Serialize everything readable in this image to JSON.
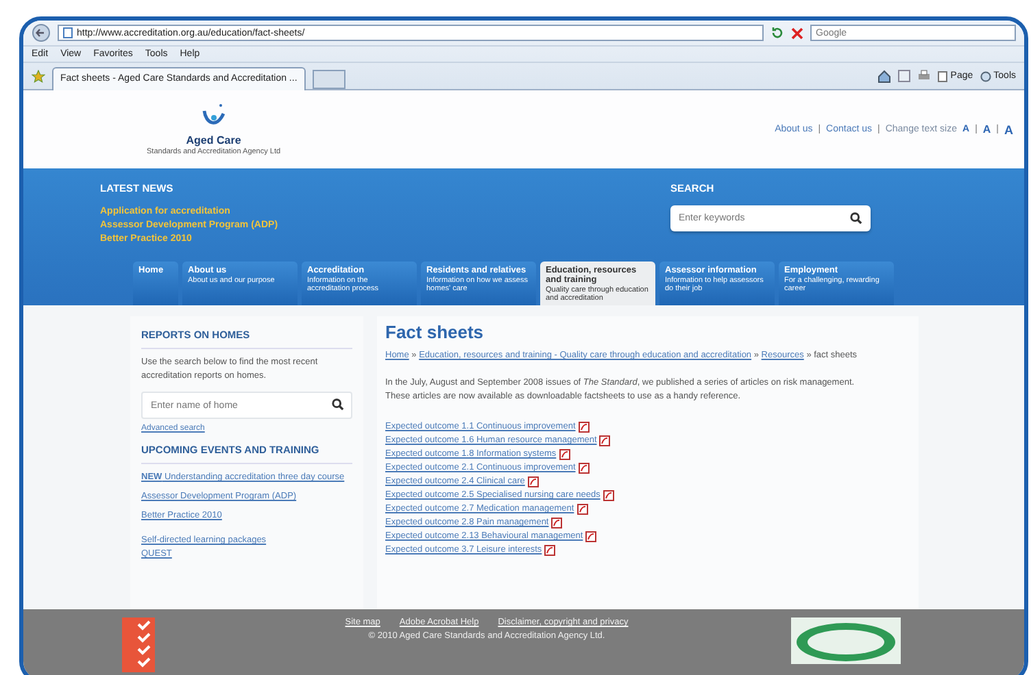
{
  "browser": {
    "address": "http://www.accreditation.org.au/education/fact-sheets/",
    "search_placeholder": "Google",
    "menu": [
      "Edit",
      "View",
      "Favorites",
      "Tools",
      "Help"
    ],
    "tabs": [
      {
        "label": "Fact sheets - Aged Care Standards and Accreditation ...",
        "selected": true
      }
    ],
    "toolbar": [
      "Page",
      "Tools"
    ]
  },
  "header": {
    "logo_title": "Aged Care",
    "logo_subtitle": "Standards and Accreditation Agency Ltd",
    "separator": "|",
    "links": [
      "About us",
      "Contact us"
    ],
    "text_size_label": "Change text size",
    "text_sizes": [
      "A",
      "A",
      "A"
    ]
  },
  "news": {
    "heading": "LATEST NEWS",
    "items": [
      "Application for accreditation",
      "Assessor Development Program (ADP)",
      "Better Practice 2010"
    ]
  },
  "search": {
    "heading": "SEARCH",
    "placeholder": "Enter keywords"
  },
  "nav": [
    {
      "title": "Home",
      "selected": false
    },
    {
      "title": "About us",
      "subtitle": "About us and our purpose",
      "selected": false
    },
    {
      "title": "Accreditation",
      "subtitle": "Information on the accreditation process",
      "selected": false
    },
    {
      "title": "Residents and relatives",
      "subtitle": "Information on how we assess homes' care",
      "selected": false
    },
    {
      "title": "Education, resources and training",
      "subtitle": "Quality care through education and accreditation",
      "selected": true
    },
    {
      "title": "Assessor information",
      "subtitle": "Information to help assessors do their job",
      "selected": false
    },
    {
      "title": "Employment",
      "subtitle": "For a challenging, rewarding career",
      "selected": false
    }
  ],
  "sidebar": {
    "reports_heading": "REPORTS ON HOMES",
    "reports_text": "Use the search below to find the most recent accreditation reports on homes.",
    "home_search_placeholder": "Enter name of home",
    "advanced_search": "Advanced search",
    "events_heading": "UPCOMING EVENTS AND TRAINING",
    "events": [
      "**NEW** Understanding accreditation three day course",
      "Assessor Development Program (ADP)",
      "Better Practice 2010"
    ],
    "more_links": [
      "Self-directed learning packages",
      "QUEST"
    ]
  },
  "main": {
    "title": "Fact sheets",
    "separator": "»",
    "breadcrumb": [
      "Home",
      "Education, resources and training - Quality care through education and accreditation",
      "Resources"
    ],
    "current": "fact sheets",
    "paragraphs": [
      "In the July, August and September 2008 issues of *The Standard*, we published a series of articles on risk management.",
      "These articles are now available as downloadable factsheets to use as a handy reference."
    ],
    "fact_sheets": [
      "Expected outcome 1.1 Continuous improvement",
      "Expected outcome 1.6 Human resource management",
      "Expected outcome 1.8 Information systems",
      "Expected outcome 2.1 Continuous improvement",
      "Expected outcome 2.4 Clinical care",
      "Expected outcome 2.5 Specialised nursing care needs",
      "Expected outcome 2.7 Medication management",
      "Expected outcome 2.8 Pain management",
      "Expected outcome 2.13 Behavioural management",
      "Expected outcome 3.7 Leisure interests"
    ]
  },
  "footer": {
    "links": [
      "Site map",
      "Adobe Acrobat Help",
      "Disclaimer, copyright and privacy"
    ],
    "copyright": "© 2010 Aged Care Standards and Accreditation Agency Ltd."
  }
}
